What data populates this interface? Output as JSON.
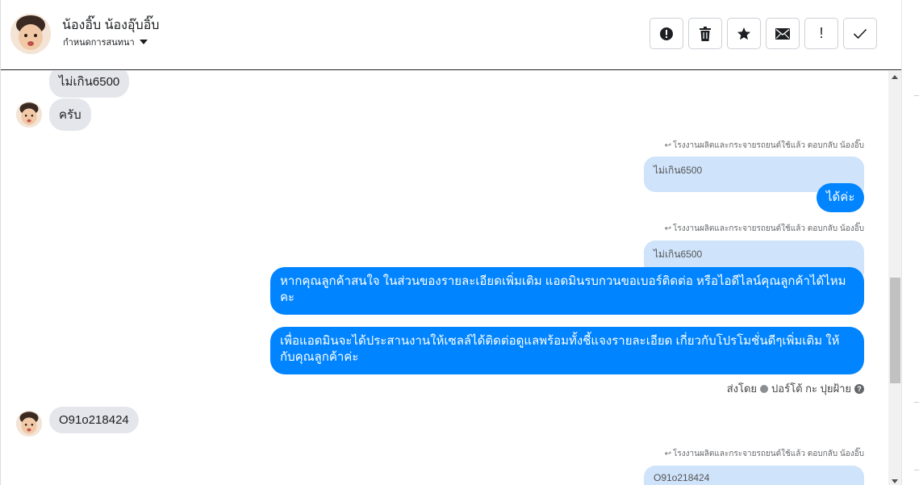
{
  "header": {
    "name": "น้องอิ๊บ น้องอุ๊บอิ๊บ",
    "subtitle": "กำหนดการสนทนา",
    "tools": [
      {
        "name": "report-icon",
        "label": "!"
      },
      {
        "name": "trash-icon",
        "label": ""
      },
      {
        "name": "star-icon",
        "label": ""
      },
      {
        "name": "mail-icon",
        "label": ""
      },
      {
        "name": "exclamation-icon",
        "label": "!"
      },
      {
        "name": "check-icon",
        "label": ""
      }
    ]
  },
  "messages": {
    "m1": "ไม่เกิน6500",
    "m2": "ครับ",
    "reply1_note": "โรงงานผลิตและกระจายรถยนต์ใช้แล้ว ตอบกลับ น้องอิ๊บ",
    "reply1_quote": "ไม่เกิน6500",
    "reply1_text": "ได้ค่ะ",
    "reply2_note": "โรงงานผลิตและกระจายรถยนต์ใช้แล้ว ตอบกลับ น้องอิ๊บ",
    "reply2_quote": "ไม่เกิน6500",
    "reply2_text": "หากคุณลูกค้าสนใจ ในส่วนของรายละเอียดเพิ่มเติม แอดมินรบกวนขอเบอร์ติดต่อ หรือไอดีไลน์คุณลูกค้าได้ไหมคะ",
    "reply3_text": "เพื่อแอดมินจะได้ประสานงานให้เซลล์ได้ติดต่อดูแลพร้อมทั้งชี้แจงรายละเอียด เกี่ยวกับโปรโมชั่นดีๆเพิ่มเติม ให้กับคุณลูกค้าค่ะ",
    "sent_by_label": "ส่งโดย",
    "sent_by_name": "ปอร์โต้ กะ ปุยฝ้าย",
    "m3": "O91o218424",
    "reply4_note": "โรงงานผลิตและกระจายรถยนต์ใช้แล้ว ตอบกลับ น้องอิ๊บ",
    "reply4_quote": "O91o218424"
  },
  "colors": {
    "outgoing": "#0084ff",
    "incoming": "#e4e6eb",
    "quote": "#cfe3fb"
  }
}
